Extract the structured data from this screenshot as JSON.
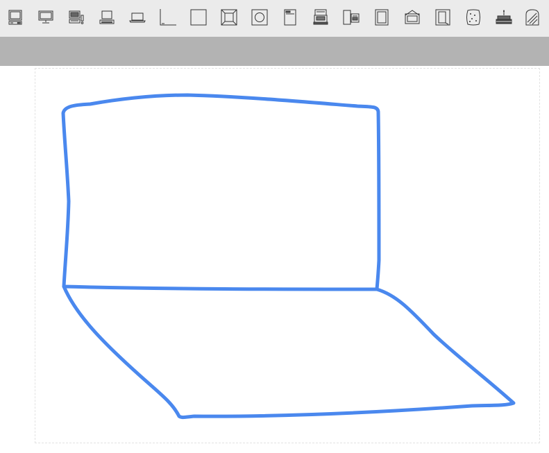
{
  "toolbar": {
    "tools": [
      "desktop-computer-icon",
      "monitor-icon",
      "workstation-icon",
      "laptop-icon",
      "notebook-icon",
      "corner-line-icon",
      "square-icon",
      "beveled-frame-icon",
      "circle-in-square-icon",
      "document-icon",
      "printer-icon",
      "device-pair-icon",
      "picture-frame-icon",
      "hanging-frame-icon",
      "tall-frame-icon",
      "dotted-shape-icon",
      "cake-icon",
      "bread-slice-icon"
    ]
  },
  "colors": {
    "toolbar_bg": "#ebebeb",
    "secondary_bar": "#b3b3b3",
    "stroke": "#4a88ee",
    "canvas_border": "#e2e2e2"
  }
}
